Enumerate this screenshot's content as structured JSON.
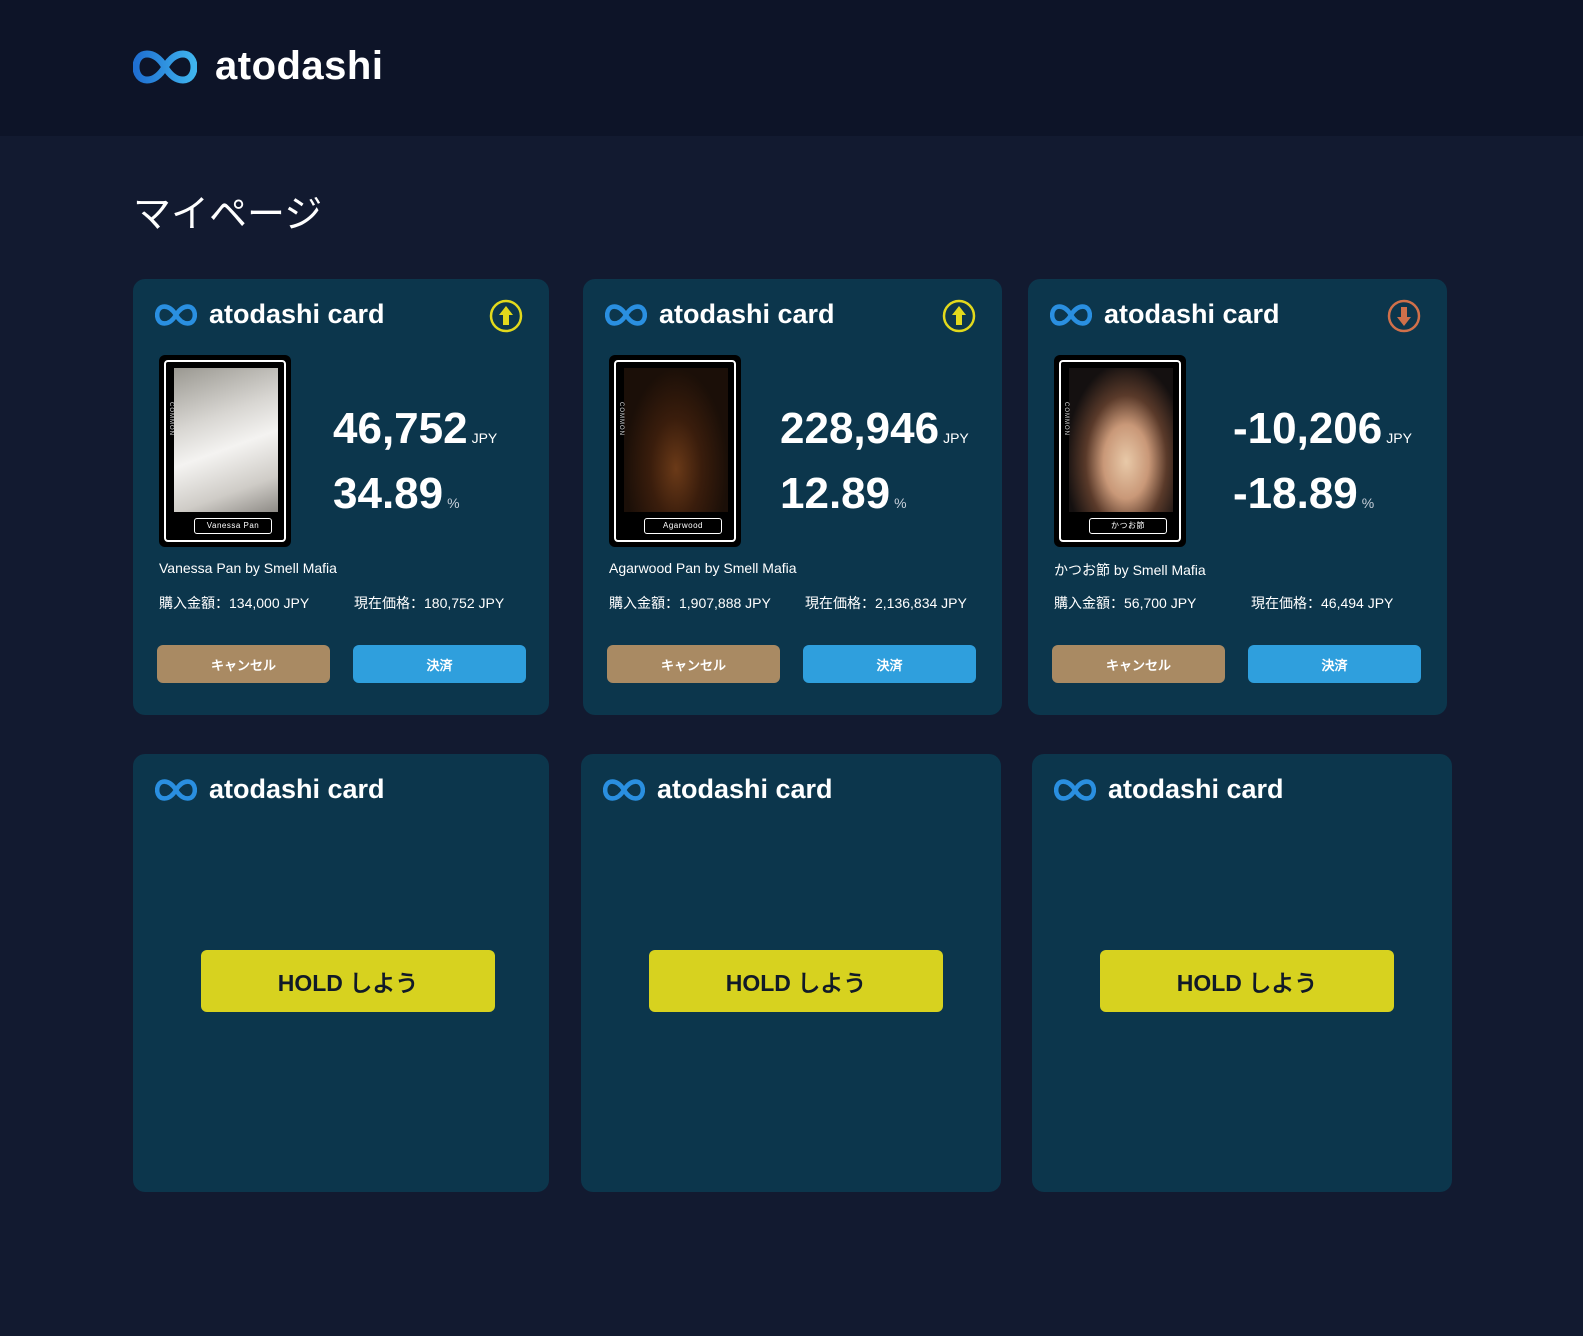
{
  "header": {
    "brand": "atodashi",
    "logo_icon": "infinity-logo-icon"
  },
  "page": {
    "title": "マイページ"
  },
  "colors": {
    "accent": "#2f9fdd",
    "cancel": "#a98a63",
    "hold": "#d7d21f",
    "trend_up": "#e2d91c",
    "trend_down": "#d0704a",
    "card_bg": "#0c364c"
  },
  "cards": [
    {
      "title": "atodashi card",
      "trend": "up",
      "trend_icon": "arrow-up-circle-icon",
      "image_label": "Vanessa Pan",
      "amount": "46,752",
      "amount_unit": "JPY",
      "percent": "34.89",
      "percent_unit": "%",
      "product": "Vanessa Pan by Smell Mafia",
      "purchase": "購入金額：134,000 JPY",
      "current": "現在価格：180,752 JPY",
      "cancel_label": "キャンセル",
      "pay_label": "決済"
    },
    {
      "title": "atodashi card",
      "trend": "up",
      "trend_icon": "arrow-up-circle-icon",
      "image_label": "Agarwood",
      "amount": "228,946",
      "amount_unit": "JPY",
      "percent": "12.89",
      "percent_unit": "%",
      "product": "Agarwood Pan by Smell Mafia",
      "purchase": "購入金額：1,907,888 JPY",
      "current": "現在価格：2,136,834 JPY",
      "cancel_label": "キャンセル",
      "pay_label": "決済"
    },
    {
      "title": "atodashi card",
      "trend": "down",
      "trend_icon": "arrow-down-circle-icon",
      "image_label": "かつお節",
      "amount": "-10,206",
      "amount_unit": "JPY",
      "percent": "-18.89",
      "percent_unit": "%",
      "product": "かつお節 by Smell Mafia",
      "purchase": "購入金額：56,700 JPY",
      "current": "現在価格：46,494 JPY",
      "cancel_label": "キャンセル",
      "pay_label": "決済"
    }
  ],
  "empty_cards": [
    {
      "title": "atodashi card",
      "hold_label": "HOLD しよう"
    },
    {
      "title": "atodashi card",
      "hold_label": "HOLD しよう"
    },
    {
      "title": "atodashi card",
      "hold_label": "HOLD しよう"
    }
  ]
}
